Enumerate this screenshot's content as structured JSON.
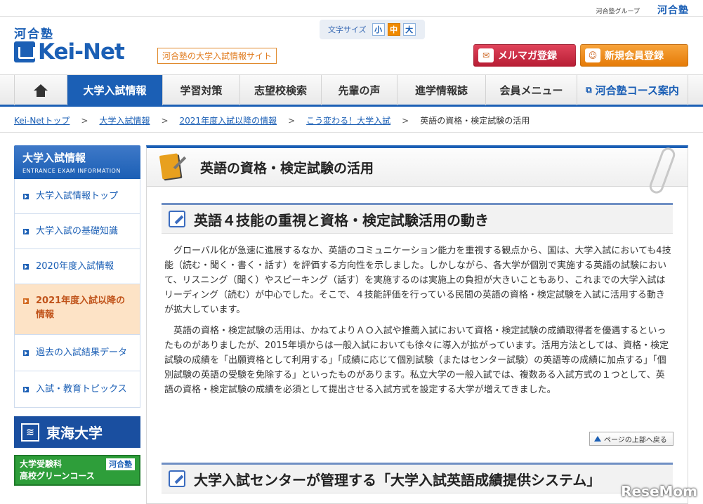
{
  "topbar": {
    "group_text": "河合塾グループ",
    "group_logo": "河合塾"
  },
  "header": {
    "logo_kawai": "河合塾",
    "logo_word": "Kei-Net",
    "tagline": "河合塾の大学入試情報サイト",
    "font_size": {
      "label": "文字サイズ",
      "small": "小",
      "medium": "中",
      "large": "大",
      "selected": "中"
    },
    "mailmag_button": "メルマガ登録",
    "register_button": "新規会員登録"
  },
  "nav": {
    "items": [
      "大学入試情報",
      "学習対策",
      "志望校検索",
      "先輩の声",
      "進学情報誌",
      "会員メニュー",
      "河合塾コース案内"
    ],
    "active": "大学入試情報"
  },
  "breadcrumb": {
    "items": [
      "Kei-Netトップ",
      "大学入試情報",
      "2021年度入試以降の情報",
      "こう変わる！大学入試"
    ],
    "current": "英語の資格・検定試験の活用",
    "separator": ">"
  },
  "sidebar": {
    "title": "大学入試情報",
    "subtitle": "ENTRANCE EXAM INFORMATION",
    "items": [
      "大学入試情報トップ",
      "大学入試の基礎知識",
      "2020年度入試情報",
      "2021年度入試以降の情報",
      "過去の入試結果データ",
      "入試・教育トピックス"
    ],
    "active": "2021年度入試以降の情報",
    "banner1": "東海大学",
    "banner2_line1": "大学受験科",
    "banner2_line2": "高校グリーンコース",
    "banner2_logo": "河合塾"
  },
  "main": {
    "page_title": "英語の資格・検定試験の活用",
    "section1_title": "英語４技能の重視と資格・検定試験活用の動き",
    "para1": "グローバル化が急速に進展するなか、英語のコミュニケーション能力を重視する観点から、国は、大学入試においても4技能（読む・聞く・書く・話す）を評価する方向性を示しました。しかしながら、各大学が個別で実施する英語の試験において、リスニング（聞く）やスピーキング（話す）を実施するのは実施上の負担が大きいこともあり、これまでの大学入試はリーディング（読む）が中心でした。そこで、４技能評価を行っている民間の英語の資格・検定試験を入試に活用する動きが拡大しています。",
    "para2": "英語の資格・検定試験の活用は、かねてよりＡＯ入試や推薦入試において資格・検定試験の成績取得者を優遇するといったものがありましたが、2015年頃からは一般入試においても徐々に導入が拡がっています。活用方法としては、資格・検定試験の成績を「出願資格として利用する」「成績に応じて個別試験（またはセンター試験）の英語等の成績に加点する」「個別試験の英語の受験を免除する」といったものがあります。私立大学の一般入試では、複数ある入試方式の１つとして、英語の資格・検定試験の成績を必須として提出させる入試方式を設定する大学が増えてきました。",
    "to_top": "ページの上部へ戻る",
    "section2_title": "大学入試センターが管理する「大学入試英語成績提供システム」"
  },
  "watermark": "ReseMom"
}
